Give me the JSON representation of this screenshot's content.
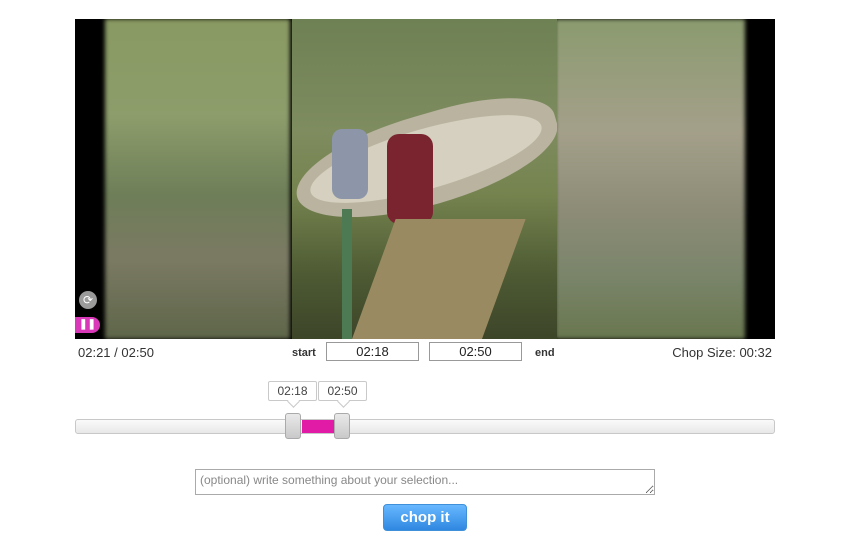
{
  "player": {
    "current_time": "02:21",
    "duration": "02:50",
    "time_separator": " / ",
    "loop_icon": "loop-icon",
    "pause_icon": "pause-icon"
  },
  "range": {
    "start_label": "start",
    "end_label": "end",
    "start_value": "02:18",
    "end_value": "02:50",
    "chop_size_label": "Chop Size: ",
    "chop_size_value": "00:32"
  },
  "slider": {
    "start_tooltip": "02:18",
    "end_tooltip": "02:50",
    "accent_color": "#e21ba6"
  },
  "note": {
    "placeholder": "(optional) write something about your selection..."
  },
  "actions": {
    "chop_label": "chop it",
    "button_color": "#2f87e0"
  }
}
